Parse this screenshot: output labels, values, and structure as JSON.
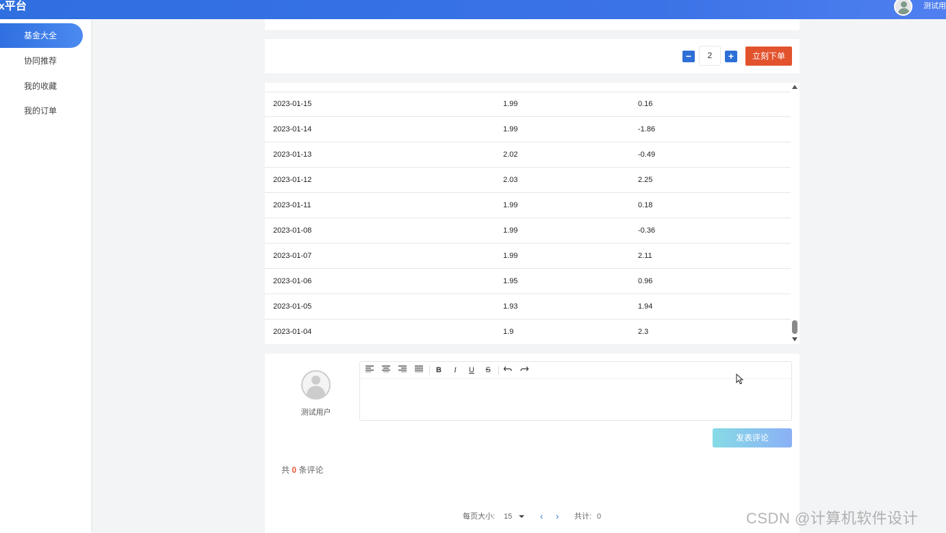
{
  "header": {
    "title": "x平台",
    "username": "测试用"
  },
  "sidebar": {
    "items": [
      {
        "label": "基金大全",
        "active": true
      },
      {
        "label": "协同推荐",
        "active": false
      },
      {
        "label": "我的收藏",
        "active": false
      },
      {
        "label": "我的订单",
        "active": false
      }
    ]
  },
  "order": {
    "minus_icon": "minus-icon",
    "quantity": "2",
    "plus_icon": "plus-icon",
    "submit_label": "立刻下单",
    "accent_color": "#e2522d",
    "brand_color": "#2d6fd6"
  },
  "nav_table": {
    "rows": [
      {
        "date": "2023-01-15",
        "nav": "1.99",
        "change": "0.16"
      },
      {
        "date": "2023-01-14",
        "nav": "1.99",
        "change": "-1.86"
      },
      {
        "date": "2023-01-13",
        "nav": "2.02",
        "change": "-0.49"
      },
      {
        "date": "2023-01-12",
        "nav": "2.03",
        "change": "2.25"
      },
      {
        "date": "2023-01-11",
        "nav": "1.99",
        "change": "0.18"
      },
      {
        "date": "2023-01-08",
        "nav": "1.99",
        "change": "-0.36"
      },
      {
        "date": "2023-01-07",
        "nav": "1.99",
        "change": "2.11"
      },
      {
        "date": "2023-01-06",
        "nav": "1.95",
        "change": "0.96"
      },
      {
        "date": "2023-01-05",
        "nav": "1.93",
        "change": "1.94"
      },
      {
        "date": "2023-01-04",
        "nav": "1.9",
        "change": "2.3"
      }
    ]
  },
  "comments": {
    "user_name": "测试用户",
    "toolbar": {
      "align_left": "align-left-icon",
      "align_center": "align-center-icon",
      "align_right": "align-right-icon",
      "justify": "justify-icon",
      "bold": "B",
      "italic": "I",
      "underline": "U",
      "strike": "S",
      "undo": "undo-icon",
      "redo": "redo-icon"
    },
    "submit_label": "发表评论",
    "count_prefix": "共",
    "count_value": "0",
    "count_suffix": "条评论",
    "pager": {
      "page_size_label": "每页大小:",
      "page_size_value": "15",
      "total_label": "共计:",
      "total_value": "0"
    }
  },
  "watermark": "CSDN @计算机软件设计"
}
